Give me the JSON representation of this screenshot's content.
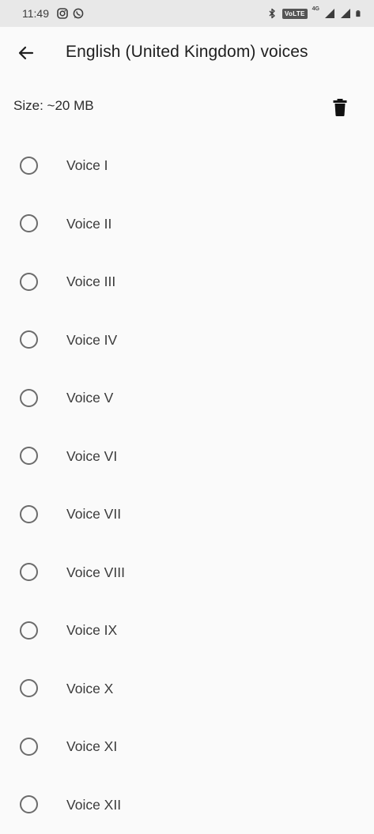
{
  "status_bar": {
    "time": "11:49",
    "left_icons": [
      "instagram-icon",
      "whatsapp-icon"
    ],
    "right_icons": [
      "bluetooth-icon",
      "volte-badge",
      "4g-signal-icon",
      "signal-icon",
      "battery-icon"
    ],
    "volte_text": "VoLTE",
    "network_text": "4G"
  },
  "app_bar": {
    "title": "English (United Kingdom) voices",
    "back_icon": "arrow-back-icon"
  },
  "size_row": {
    "label": "Size: ~20 MB",
    "delete_icon": "trash-icon"
  },
  "voices": [
    {
      "label": "Voice I",
      "selected": false
    },
    {
      "label": "Voice II",
      "selected": false
    },
    {
      "label": "Voice III",
      "selected": false
    },
    {
      "label": "Voice IV",
      "selected": false
    },
    {
      "label": "Voice V",
      "selected": false
    },
    {
      "label": "Voice VI",
      "selected": false
    },
    {
      "label": "Voice VII",
      "selected": false
    },
    {
      "label": "Voice VIII",
      "selected": false
    },
    {
      "label": "Voice IX",
      "selected": false
    },
    {
      "label": "Voice X",
      "selected": false
    },
    {
      "label": "Voice XI",
      "selected": false
    },
    {
      "label": "Voice XII",
      "selected": false
    }
  ],
  "colors": {
    "background": "#fafafa",
    "status_bar": "#e8e8e8",
    "radio_border": "#6b6b6b",
    "text_primary": "#1f1f1f"
  }
}
